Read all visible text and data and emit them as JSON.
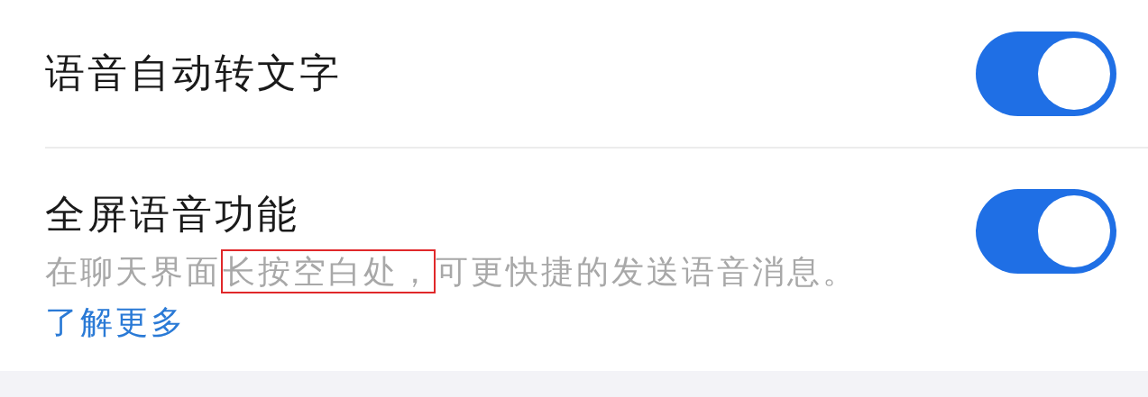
{
  "settings": [
    {
      "title": "语音自动转文字",
      "on": true
    },
    {
      "title": "全屏语音功能",
      "on": true,
      "description": {
        "parts": [
          {
            "text": "在聊天界面",
            "highlighted": false
          },
          {
            "text": "长按空白处，",
            "highlighted": true
          },
          {
            "text": "可更快捷的发送语音消息。",
            "highlighted": false
          }
        ],
        "link": "了解更多"
      }
    }
  ]
}
